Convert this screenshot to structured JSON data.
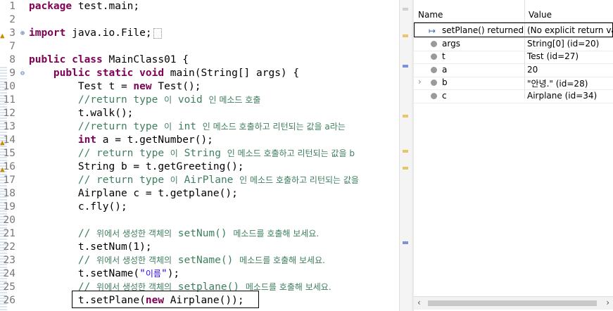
{
  "editor": {
    "lines": [
      {
        "n": "1",
        "html": "<span class=\"kw\">package</span> test.main;"
      },
      {
        "n": "2",
        "html": ""
      },
      {
        "n": "3",
        "html": "<span class=\"kw\">import</span> java.io.File;<span class=\"box-import\">&nbsp;</span>",
        "fold": true,
        "marker": true
      },
      {
        "n": "7",
        "html": ""
      },
      {
        "n": "8",
        "html": "<span class=\"kw\">public class</span> MainClass01 {"
      },
      {
        "n": "9",
        "html": "    <span class=\"kw\">public static void</span> main(String[] args) {",
        "fold": true
      },
      {
        "n": "10",
        "html": "        Test t = <span class=\"kw\">new</span> Test();"
      },
      {
        "n": "11",
        "html": "        <span class=\"cm\">//return type <span class=\"cmk\">이</span> void <span class=\"cmk\">인 메소드 호출</span></span>"
      },
      {
        "n": "12",
        "html": "        t.walk();"
      },
      {
        "n": "13",
        "html": "        <span class=\"cm\">//return type <span class=\"cmk\">이</span> int <span class=\"cmk\">인 메소드 호출하고 리턴되는 값을 a라는</span></span>"
      },
      {
        "n": "14",
        "html": "        <span class=\"kw\">int</span> a = t.getNumber();",
        "marker": true
      },
      {
        "n": "15",
        "html": "        <span class=\"cm\">// return type <span class=\"cmk\">이</span> String <span class=\"cmk\">인 메소드 호출하고 리턴되는 값을 b</span></span>"
      },
      {
        "n": "16",
        "html": "        String b = t.getGreeting();",
        "marker": true
      },
      {
        "n": "17",
        "html": "        <span class=\"cm\">// return type <span class=\"cmk\">이</span> AirPlane <span class=\"cmk\">인 메소드 호출하고 리턴되는 값을</span></span>"
      },
      {
        "n": "18",
        "html": "        Airplane c = t.getplane();"
      },
      {
        "n": "19",
        "html": "        c.fly();"
      },
      {
        "n": "20",
        "html": ""
      },
      {
        "n": "21",
        "html": "        <span class=\"cm\">// <span class=\"cmk\">위에서 생성한 객체의</span> setNum() <span class=\"cmk\">메소드를 호출해 보세요.</span></span>"
      },
      {
        "n": "22",
        "html": "        t.setNum(1);"
      },
      {
        "n": "23",
        "html": "        <span class=\"cm\">// <span class=\"cmk\">위에서 생성한 객체의</span> setName() <span class=\"cmk\">메소드를 호출해 보세요.</span></span>"
      },
      {
        "n": "24",
        "html": "        t.setName(<span class=\"str\">\"<span class=\"cmk\">이름</span>\"</span>);"
      },
      {
        "n": "25",
        "html": "        <span class=\"cm\">// <span class=\"cmk\">위에서 생성한 객체의</span> setplane() <span class=\"cmk\">메소드를 호출해 보세요.</span></span>"
      },
      {
        "n": "26",
        "html": "        t.setPlane(<span class=\"kw\">new</span> Airplane());"
      }
    ]
  },
  "variables": {
    "header_name": "Name",
    "header_value": "Value",
    "rows": [
      {
        "name": "setPlane() returned",
        "value": "(No explicit return val",
        "icon": "return-icon",
        "expandable": false
      },
      {
        "name": "args",
        "value": "String[0]  (id=20)",
        "icon": "variable-icon",
        "expandable": false
      },
      {
        "name": "t",
        "value": "Test  (id=27)",
        "icon": "variable-icon",
        "expandable": false
      },
      {
        "name": "a",
        "value": "20",
        "icon": "variable-icon",
        "expandable": false
      },
      {
        "name": "b",
        "value": "\"안녕.\" (id=28)",
        "icon": "variable-icon",
        "expandable": true
      },
      {
        "name": "c",
        "value": "Airplane  (id=34)",
        "icon": "variable-icon",
        "expandable": false
      }
    ]
  },
  "colors": {
    "keyword": "#7f0055",
    "comment": "#3f7f5f",
    "string": "#2a00ff"
  }
}
